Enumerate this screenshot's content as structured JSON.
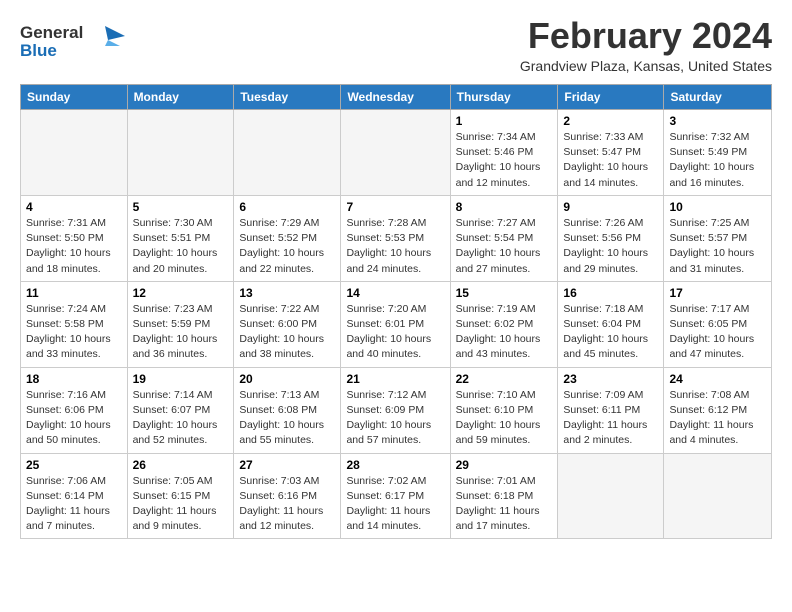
{
  "header": {
    "logo_line1": "General",
    "logo_line2": "Blue",
    "month_title": "February 2024",
    "location": "Grandview Plaza, Kansas, United States"
  },
  "weekdays": [
    "Sunday",
    "Monday",
    "Tuesday",
    "Wednesday",
    "Thursday",
    "Friday",
    "Saturday"
  ],
  "weeks": [
    [
      {
        "day": "",
        "info": ""
      },
      {
        "day": "",
        "info": ""
      },
      {
        "day": "",
        "info": ""
      },
      {
        "day": "",
        "info": ""
      },
      {
        "day": "1",
        "info": "Sunrise: 7:34 AM\nSunset: 5:46 PM\nDaylight: 10 hours\nand 12 minutes."
      },
      {
        "day": "2",
        "info": "Sunrise: 7:33 AM\nSunset: 5:47 PM\nDaylight: 10 hours\nand 14 minutes."
      },
      {
        "day": "3",
        "info": "Sunrise: 7:32 AM\nSunset: 5:49 PM\nDaylight: 10 hours\nand 16 minutes."
      }
    ],
    [
      {
        "day": "4",
        "info": "Sunrise: 7:31 AM\nSunset: 5:50 PM\nDaylight: 10 hours\nand 18 minutes."
      },
      {
        "day": "5",
        "info": "Sunrise: 7:30 AM\nSunset: 5:51 PM\nDaylight: 10 hours\nand 20 minutes."
      },
      {
        "day": "6",
        "info": "Sunrise: 7:29 AM\nSunset: 5:52 PM\nDaylight: 10 hours\nand 22 minutes."
      },
      {
        "day": "7",
        "info": "Sunrise: 7:28 AM\nSunset: 5:53 PM\nDaylight: 10 hours\nand 24 minutes."
      },
      {
        "day": "8",
        "info": "Sunrise: 7:27 AM\nSunset: 5:54 PM\nDaylight: 10 hours\nand 27 minutes."
      },
      {
        "day": "9",
        "info": "Sunrise: 7:26 AM\nSunset: 5:56 PM\nDaylight: 10 hours\nand 29 minutes."
      },
      {
        "day": "10",
        "info": "Sunrise: 7:25 AM\nSunset: 5:57 PM\nDaylight: 10 hours\nand 31 minutes."
      }
    ],
    [
      {
        "day": "11",
        "info": "Sunrise: 7:24 AM\nSunset: 5:58 PM\nDaylight: 10 hours\nand 33 minutes."
      },
      {
        "day": "12",
        "info": "Sunrise: 7:23 AM\nSunset: 5:59 PM\nDaylight: 10 hours\nand 36 minutes."
      },
      {
        "day": "13",
        "info": "Sunrise: 7:22 AM\nSunset: 6:00 PM\nDaylight: 10 hours\nand 38 minutes."
      },
      {
        "day": "14",
        "info": "Sunrise: 7:20 AM\nSunset: 6:01 PM\nDaylight: 10 hours\nand 40 minutes."
      },
      {
        "day": "15",
        "info": "Sunrise: 7:19 AM\nSunset: 6:02 PM\nDaylight: 10 hours\nand 43 minutes."
      },
      {
        "day": "16",
        "info": "Sunrise: 7:18 AM\nSunset: 6:04 PM\nDaylight: 10 hours\nand 45 minutes."
      },
      {
        "day": "17",
        "info": "Sunrise: 7:17 AM\nSunset: 6:05 PM\nDaylight: 10 hours\nand 47 minutes."
      }
    ],
    [
      {
        "day": "18",
        "info": "Sunrise: 7:16 AM\nSunset: 6:06 PM\nDaylight: 10 hours\nand 50 minutes."
      },
      {
        "day": "19",
        "info": "Sunrise: 7:14 AM\nSunset: 6:07 PM\nDaylight: 10 hours\nand 52 minutes."
      },
      {
        "day": "20",
        "info": "Sunrise: 7:13 AM\nSunset: 6:08 PM\nDaylight: 10 hours\nand 55 minutes."
      },
      {
        "day": "21",
        "info": "Sunrise: 7:12 AM\nSunset: 6:09 PM\nDaylight: 10 hours\nand 57 minutes."
      },
      {
        "day": "22",
        "info": "Sunrise: 7:10 AM\nSunset: 6:10 PM\nDaylight: 10 hours\nand 59 minutes."
      },
      {
        "day": "23",
        "info": "Sunrise: 7:09 AM\nSunset: 6:11 PM\nDaylight: 11 hours\nand 2 minutes."
      },
      {
        "day": "24",
        "info": "Sunrise: 7:08 AM\nSunset: 6:12 PM\nDaylight: 11 hours\nand 4 minutes."
      }
    ],
    [
      {
        "day": "25",
        "info": "Sunrise: 7:06 AM\nSunset: 6:14 PM\nDaylight: 11 hours\nand 7 minutes."
      },
      {
        "day": "26",
        "info": "Sunrise: 7:05 AM\nSunset: 6:15 PM\nDaylight: 11 hours\nand 9 minutes."
      },
      {
        "day": "27",
        "info": "Sunrise: 7:03 AM\nSunset: 6:16 PM\nDaylight: 11 hours\nand 12 minutes."
      },
      {
        "day": "28",
        "info": "Sunrise: 7:02 AM\nSunset: 6:17 PM\nDaylight: 11 hours\nand 14 minutes."
      },
      {
        "day": "29",
        "info": "Sunrise: 7:01 AM\nSunset: 6:18 PM\nDaylight: 11 hours\nand 17 minutes."
      },
      {
        "day": "",
        "info": ""
      },
      {
        "day": "",
        "info": ""
      }
    ]
  ]
}
